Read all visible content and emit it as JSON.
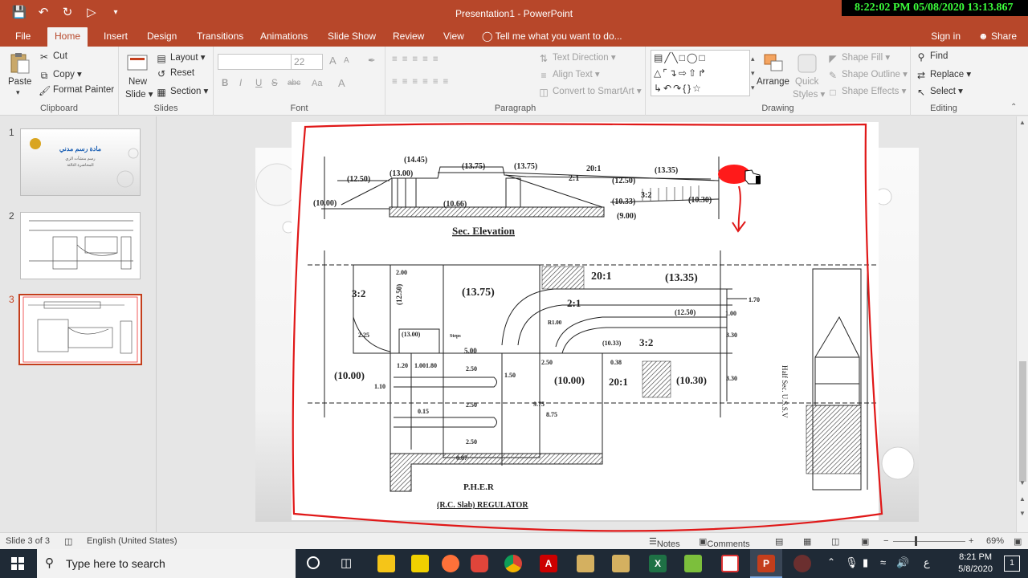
{
  "window": {
    "title": "Presentation1 - PowerPoint",
    "recorder_overlay": "8:22:02 PM 05/08/2020 13:13.867"
  },
  "tabs": [
    "File",
    "Home",
    "Insert",
    "Design",
    "Transitions",
    "Animations",
    "Slide Show",
    "Review",
    "View"
  ],
  "tell_me": "Tell me what you want to do...",
  "account": {
    "sign_in": "Sign in",
    "share": "Share"
  },
  "ribbon": {
    "clipboard": {
      "paste": "Paste",
      "cut": "Cut",
      "copy": "Copy",
      "format_painter": "Format Painter",
      "label": "Clipboard"
    },
    "slides": {
      "new_slide": "New",
      "new_slide2": "Slide",
      "layout": "Layout",
      "reset": "Reset",
      "section": "Section",
      "label": "Slides"
    },
    "font": {
      "size": "22",
      "bold": "B",
      "italic": "I",
      "underline": "U",
      "strike": "S",
      "spacing": "abc",
      "case": "Aa",
      "color": "A",
      "grow": "A",
      "shrink": "A",
      "label": "Font"
    },
    "paragraph": {
      "text_direction": "Text Direction",
      "align_text": "Align Text",
      "convert_smartart": "Convert to SmartArt",
      "label": "Paragraph"
    },
    "drawing": {
      "arrange": "Arrange",
      "quick_styles": "Quick",
      "quick_styles2": "Styles",
      "shape_fill": "Shape Fill",
      "shape_outline": "Shape Outline",
      "shape_effects": "Shape Effects",
      "label": "Drawing"
    },
    "editing": {
      "find": "Find",
      "replace": "Replace",
      "select": "Select",
      "label": "Editing"
    }
  },
  "thumbnails": [
    {
      "num": "1",
      "title": "مادة رسم مدني",
      "sub": "رسم منشآت الري",
      "sub2": "المحاضرة الثالثة"
    },
    {
      "num": "2"
    },
    {
      "num": "3"
    }
  ],
  "drawing": {
    "elev_labels": [
      "(14.45)",
      "(13.75)",
      "(13.75)",
      "(12.50)",
      "(13.00)",
      "20:1",
      "(13.35)",
      "2:1",
      "(12.50)",
      "(10.00)",
      "(10.66)",
      "3:2",
      "(10.33)",
      "(10.30)",
      "(9.00)"
    ],
    "elev_title": "Sec. Elevation",
    "plan_labels": [
      "3:2",
      "2.00",
      "(12.50)",
      "(13.75)",
      "20:1",
      "(13.35)",
      "2:1",
      "1.70",
      "(12.50)",
      "1.00",
      "(13.00)",
      "R1.00",
      "3.30",
      "2.25",
      "Steps",
      "(10.33)",
      "3:2",
      "5.00",
      "(10.00)",
      "1.20",
      "1.00",
      "1.80",
      "2.50",
      "1.50",
      "2.50",
      "0.38",
      "(10.00)",
      "20:1",
      "(10.30)",
      "3.30",
      "1.10",
      "0.15",
      "2.50",
      "9.75",
      "8.75",
      "2.50",
      "0.87"
    ],
    "plan_title": "P.H.E.R",
    "plan_subtitle": "(R.C. Slab) REGULATOR",
    "side_title": "Half Sec. U.S.S.V"
  },
  "status": {
    "slide": "Slide 3 of 3",
    "language": "English (United States)",
    "notes": "Notes",
    "comments": "Comments",
    "zoom": "69%"
  },
  "taskbar": {
    "search_placeholder": "Type here to search",
    "time": "8:21 PM",
    "date": "5/8/2020",
    "lang": "ع",
    "notifications": "1"
  }
}
